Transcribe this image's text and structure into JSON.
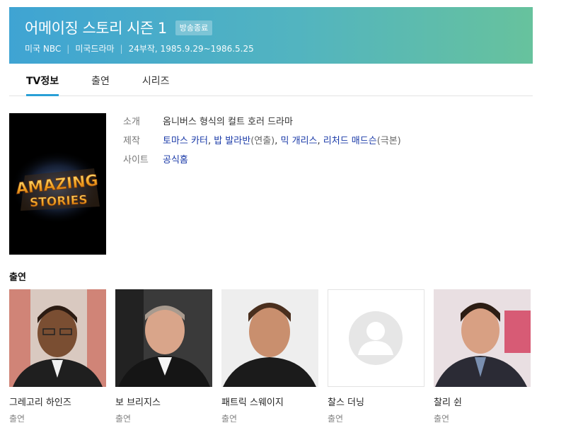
{
  "header": {
    "title": "어메이징 스토리 시즌 1",
    "badge": "방송종료",
    "meta": [
      "미국 NBC",
      "미국드라마",
      "24부작, 1985.9.29~1986.5.25"
    ]
  },
  "tabs": [
    {
      "label": "TV정보",
      "active": true
    },
    {
      "label": "출연",
      "active": false
    },
    {
      "label": "시리즈",
      "active": false
    }
  ],
  "poster": {
    "line1": "AMAZING",
    "line2": "STORIES"
  },
  "info": {
    "intro_key": "소개",
    "intro_val": "옴니버스 형식의 컬트 호러 드라마",
    "prod_key": "제작",
    "prod_link1": "토마스 카터",
    "prod_comma1": ", ",
    "prod_link2": "밥 발라반",
    "prod_note1": "(연출)",
    "prod_comma2": ", ",
    "prod_link3": "믹 개리스",
    "prod_comma3": ", ",
    "prod_link4": "리처드 매드슨",
    "prod_note2": "(극본)",
    "site_key": "사이트",
    "site_val": "공식홈"
  },
  "cast_heading": "출연",
  "cast": [
    {
      "name": "그레고리 하인즈",
      "role": "출연"
    },
    {
      "name": "보 브리지스",
      "role": "출연"
    },
    {
      "name": "패트릭 스웨이지",
      "role": "출연"
    },
    {
      "name": "찰스 더닝",
      "role": "출연"
    },
    {
      "name": "찰리 쉰",
      "role": "출연"
    }
  ],
  "colors": {
    "accent": "#2a9fd6",
    "link": "#1a3aa8",
    "header_start": "#3fa4d3",
    "header_end": "#67c29d"
  }
}
